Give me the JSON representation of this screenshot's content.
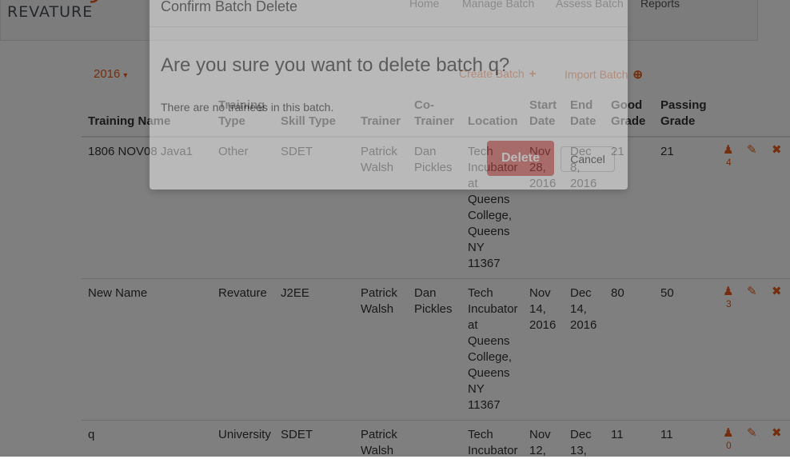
{
  "header": {
    "logo_text": "REVATURE",
    "nav": [
      "Home",
      "Manage Batch",
      "Assess Batch",
      "Reports"
    ]
  },
  "toolbar": {
    "year": "2016",
    "create_label": "Create Batch",
    "import_label": "Import Batch"
  },
  "table": {
    "headers": [
      "Training Name",
      "Training\nType",
      "Skill Type",
      "Trainer",
      "Co-\nTrainer",
      "Location",
      "Start\nDate",
      "End\nDate",
      "Good\nGrade",
      "Passing\nGrade"
    ],
    "rows": [
      {
        "cells": [
          "1806 NOV08 Java1",
          "Other",
          "SDET",
          "Patrick\nWalsh",
          "Dan\nPickles",
          "Tech\nIncubator\nat\nQueens\nCollege,\nQueens\nNY\n11367",
          "Nov\n28,\n2016",
          "Dec\n8,\n2016",
          "21",
          "21"
        ],
        "trainee_count": "4"
      },
      {
        "cells": [
          "New Name",
          "Revature",
          "J2EE",
          "Patrick\nWalsh",
          "Dan\nPickles",
          "Tech\nIncubator\nat\nQueens\nCollege,\nQueens\nNY\n11367",
          "Nov\n14,\n2016",
          "Dec\n14,\n2016",
          "80",
          "50"
        ],
        "trainee_count": "3"
      },
      {
        "cells": [
          "q",
          "University",
          "SDET",
          "Patrick\nWalsh",
          "",
          "Tech\nIncubator",
          "Nov\n12,",
          "Dec\n13,",
          "11",
          "11"
        ],
        "trainee_count": "0"
      }
    ]
  },
  "modal": {
    "title": "Confirm Batch Delete",
    "question": "Are you sure you want to delete batch q?",
    "subtext": "There are no trainees in this batch.",
    "delete_label": "Delete",
    "cancel_label": "Cancel"
  },
  "colors": {
    "accent": "#e85c1a",
    "danger": "#d9534f"
  }
}
